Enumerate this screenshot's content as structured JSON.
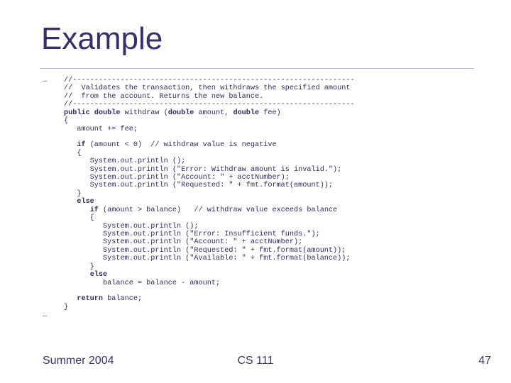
{
  "title": "Example",
  "ellipsis": "…",
  "code": {
    "sep": "//-----------------------------------------------------------------",
    "cmt1": "//  Validates the transaction, then withdraws the specified amount",
    "cmt2": "//  from the account. Returns the new balance.",
    "sig_1": "public double",
    "sig_2": " withdraw (",
    "sig_3": "double",
    "sig_4": " amount, ",
    "sig_5": "double",
    "sig_6": " fee)",
    "l_openbrace": "{",
    "l_fee": "   amount += fee;",
    "l_blank": "",
    "if_1": "   ",
    "if_kw": "if",
    "if_2": " (amount < 0)  // withdraw value is negative",
    "l_open1": "   {",
    "p1a": "      System.out.println ();",
    "p1b": "      System.out.println (\"Error: Withdraw amount is invalid.\");",
    "p1c": "      System.out.println (\"Account: \" + acctNumber);",
    "p1d": "      System.out.println (\"Requested: \" + fmt.format(amount));",
    "l_close1": "   }",
    "else1_ind": "   ",
    "else_kw": "else",
    "if2_1": "      ",
    "if2_kw": "if",
    "if2_2": " (amount > balance)   // withdraw value exceeds balance",
    "l_open2": "      {",
    "p2a": "         System.out.println ();",
    "p2b": "         System.out.println (\"Error: Insufficient funds.\");",
    "p2c": "         System.out.println (\"Account: \" + acctNumber);",
    "p2d": "         System.out.println (\"Requested: \" + fmt.format(amount));",
    "p2e": "         System.out.println (\"Available: \" + fmt.format(balance));",
    "l_close2": "      }",
    "else2_ind": "      ",
    "l_assign": "         balance = balance - amount;",
    "ret_ind": "   ",
    "ret_kw": "return",
    "ret_2": " balance;",
    "l_closebrace": "}"
  },
  "footer": {
    "left": "Summer 2004",
    "center": "CS 111",
    "right": "47"
  }
}
